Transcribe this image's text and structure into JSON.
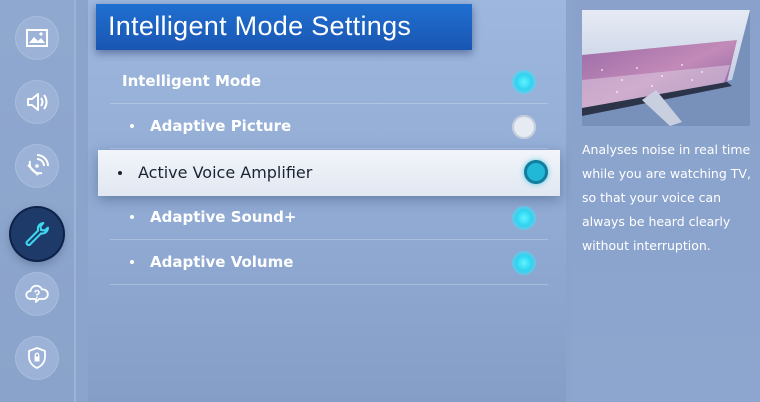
{
  "panel_title": "Intelligent Mode Settings",
  "rows": [
    {
      "label": "Intelligent Mode",
      "state": "on"
    },
    {
      "label": "Adaptive Picture",
      "state": "off"
    },
    {
      "label": "Active Voice Amplifier",
      "state": "on",
      "focused": true
    },
    {
      "label": "Adaptive Sound+",
      "state": "on"
    },
    {
      "label": "Adaptive Volume",
      "state": "on"
    }
  ],
  "rail_icons": [
    {
      "name": "picture-icon"
    },
    {
      "name": "sound-icon"
    },
    {
      "name": "broadcasting-icon"
    },
    {
      "name": "general-wrench-icon",
      "active": true
    },
    {
      "name": "support-cloud-icon"
    },
    {
      "name": "privacy-shield-icon"
    }
  ],
  "description": "Analyses noise in real time while you are watching TV, so that your voice can always be heard clearly without interruption.",
  "colors": {
    "title_bg": "#1f6fd0",
    "toggle_on": "#2fd4f0",
    "toggle_off": "#e6ebf3",
    "active_rail": "#1d3a69"
  }
}
